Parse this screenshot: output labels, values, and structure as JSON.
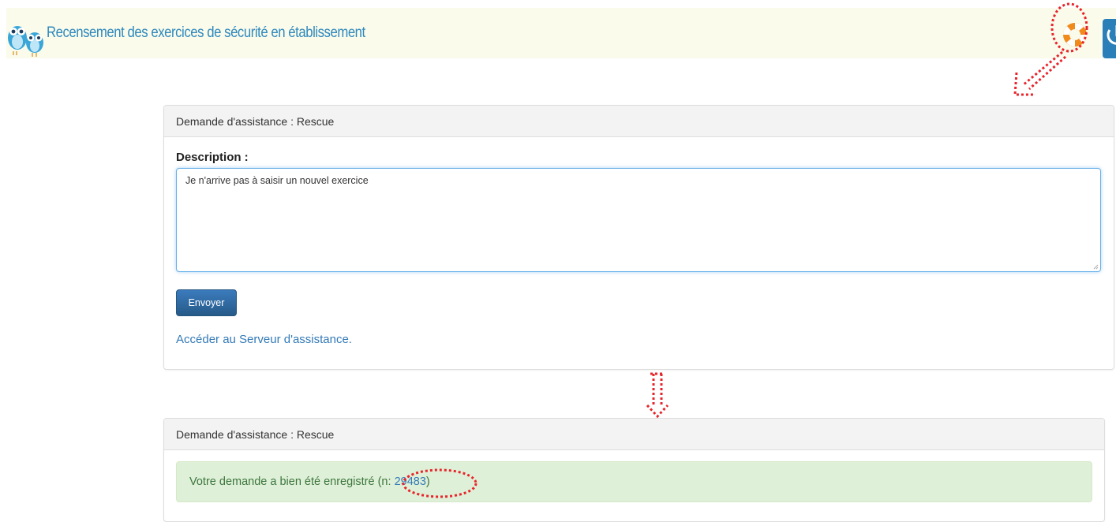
{
  "header": {
    "title": "Recensement des exercices de sécurité en établissement",
    "help_icon": "lifebuoy-icon",
    "power_icon": "power-icon",
    "logo_icon": "owls-logo-icon"
  },
  "request_form": {
    "heading": "Demande d'assistance : Rescue",
    "description_label": "Description :",
    "description_value": "Je n'arrive pas à saisir un nouvel exercice",
    "send_label": "Envoyer",
    "server_link": "Accéder au Serveur d'assistance."
  },
  "confirmation": {
    "heading": "Demande d'assistance : Rescue",
    "message": "Votre demande a bien été enregistré",
    "ticket_prefix": " (n: ",
    "ticket_number": "29483",
    "ticket_suffix": ")"
  },
  "colors": {
    "accent": "#2e88bd",
    "header_bg": "#fafbeb",
    "annotation": "#e8242b",
    "success_bg": "#dff0d8"
  }
}
